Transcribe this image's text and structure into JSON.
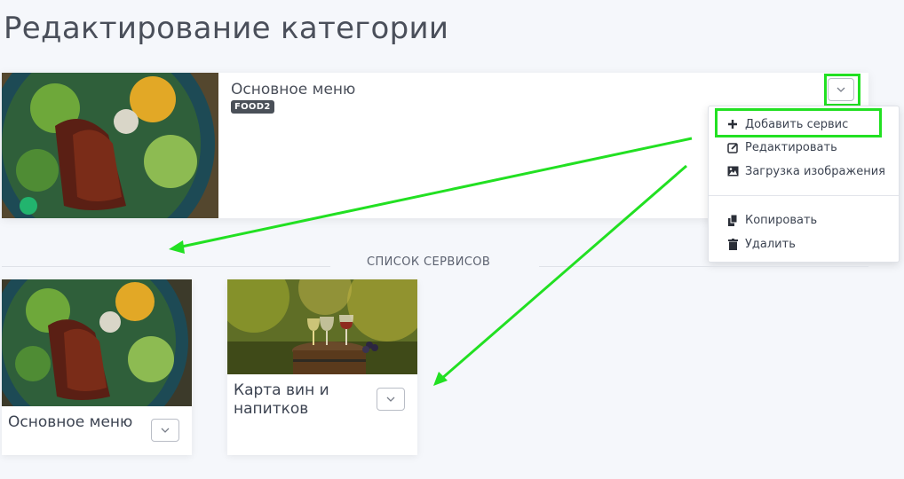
{
  "page": {
    "title": "Редактирование категории"
  },
  "category": {
    "name": "Основное меню",
    "badge": "FOOD2"
  },
  "dropdown": {
    "items": [
      {
        "label": "Добавить сервис",
        "icon": "plus-icon"
      },
      {
        "label": "Редактировать",
        "icon": "edit-icon"
      },
      {
        "label": "Загрузка изображения",
        "icon": "image-icon"
      },
      {
        "label": "Копировать",
        "icon": "copy-icon"
      },
      {
        "label": "Удалить",
        "icon": "trash-icon"
      }
    ]
  },
  "services_section": {
    "title": "СПИСОК СЕРВИСОВ"
  },
  "services": [
    {
      "name": "Основное меню"
    },
    {
      "name": "Карта вин и напитков"
    }
  ],
  "colors": {
    "highlight": "#22e022",
    "background": "#f5f7fb",
    "badge": "#4a5058"
  }
}
